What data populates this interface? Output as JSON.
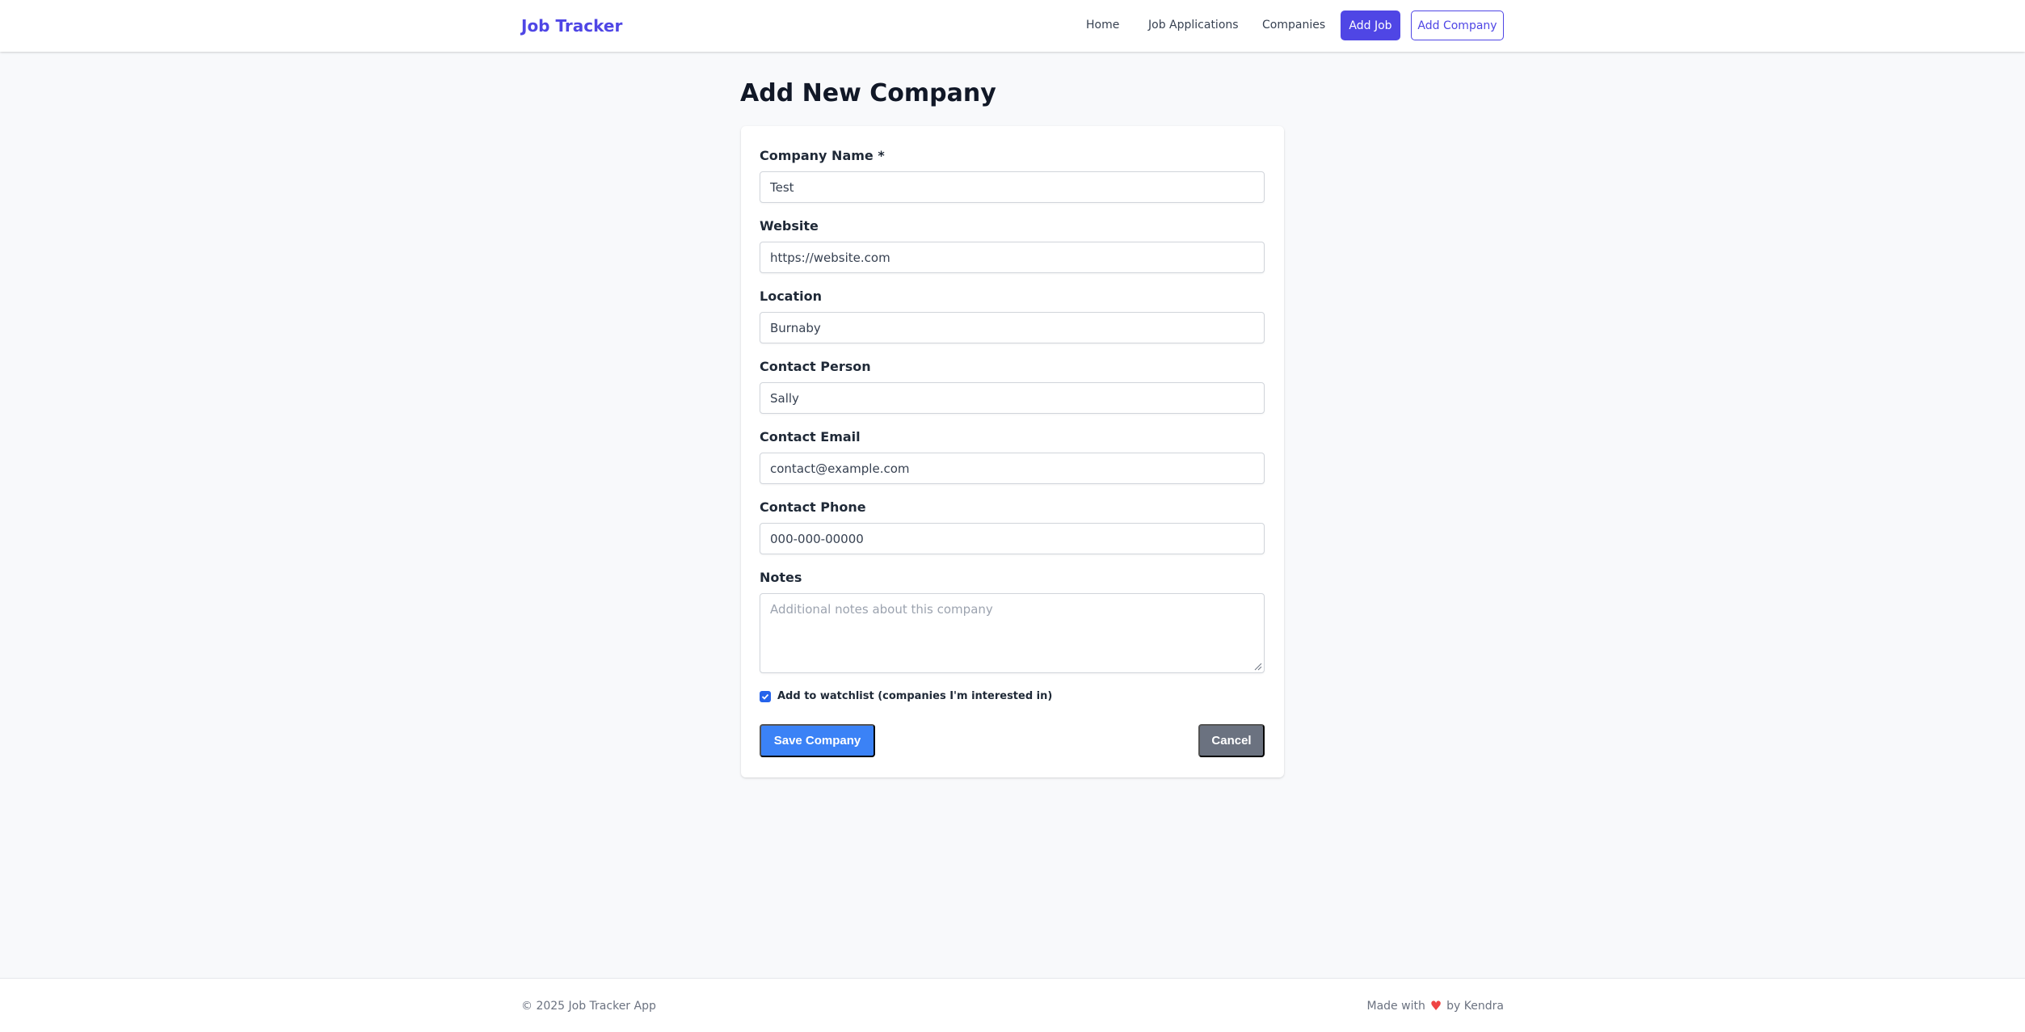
{
  "header": {
    "brand": "Job Tracker",
    "nav": {
      "home": "Home",
      "job_applications": "Job Applications",
      "companies": "Companies",
      "add_job": "Add Job",
      "add_company": "Add Company"
    }
  },
  "page_title": "Add New Company",
  "form": {
    "company_name": {
      "label": "Company Name *",
      "value": "Test"
    },
    "website": {
      "label": "Website",
      "value": "https://website.com"
    },
    "location": {
      "label": "Location",
      "value": "Burnaby"
    },
    "contact_person": {
      "label": "Contact Person",
      "value": "Sally"
    },
    "contact_email": {
      "label": "Contact Email",
      "value": "contact@example.com"
    },
    "contact_phone": {
      "label": "Contact Phone",
      "value": "000-000-00000"
    },
    "notes": {
      "label": "Notes",
      "placeholder": "Additional notes about this company"
    },
    "watchlist": {
      "label": "Add to watchlist (companies I'm interested in)",
      "checked": true
    },
    "save_label": "Save Company",
    "cancel_label": "Cancel"
  },
  "footer": {
    "copyright": "© 2025 Job Tracker App",
    "made_with_prefix": "Made with",
    "made_with_suffix": "by Kendra"
  },
  "colors": {
    "brand": "#4f46e5",
    "primary_button": "#3b82f6",
    "cancel_button": "#6b7280",
    "heart": "#ef4444"
  },
  "icons": [
    "heart-icon",
    "checkmark-icon",
    "resize-grip-icon"
  ]
}
